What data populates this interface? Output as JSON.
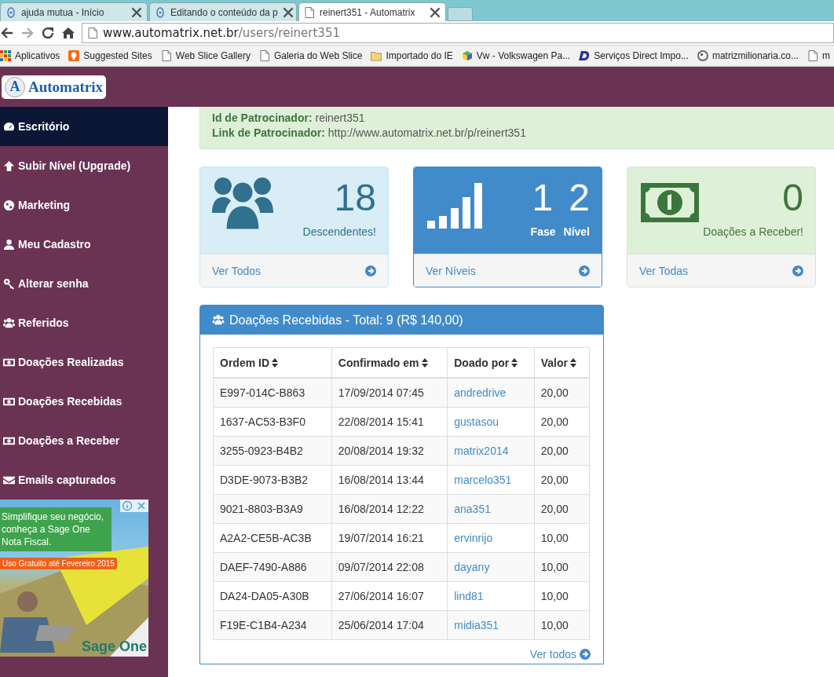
{
  "browser": {
    "tabs": [
      {
        "title": "ajuda mutua - Início",
        "kind": "site",
        "selected": false
      },
      {
        "title": "Editando o conteúdo da p",
        "kind": "site",
        "selected": false
      },
      {
        "title": "reinert351 - Automatrix",
        "kind": "page",
        "selected": true
      }
    ],
    "address": {
      "host": "www.automatrix.net.br",
      "path": "/users/reinert351"
    },
    "bookmarks": [
      {
        "label": "Aplicativos",
        "kind": "apps"
      },
      {
        "label": "Suggested Sites",
        "kind": "suggest"
      },
      {
        "label": "Web Slice Gallery",
        "kind": "page"
      },
      {
        "label": "Galeria do Web Slice",
        "kind": "page"
      },
      {
        "label": "Importado do IE",
        "kind": "folder"
      },
      {
        "label": "Vw - Volkswagen Pa...",
        "kind": "cube"
      },
      {
        "label": "Serviços Direct Impo...",
        "kind": "d"
      },
      {
        "label": "matrizmilionaria.co...",
        "kind": "globe"
      },
      {
        "label": "m",
        "kind": "page"
      }
    ]
  },
  "header": {
    "logo_letter": "A",
    "logo_text": "Automatrix"
  },
  "sidebar": {
    "items": [
      {
        "label": "Escritório",
        "kind": "dashboard",
        "selected": true
      },
      {
        "label": "Subir Nível (Upgrade)",
        "kind": "upgrade",
        "selected": false
      },
      {
        "label": "Marketing",
        "kind": "globe",
        "selected": false
      },
      {
        "label": "Meu Cadastro",
        "kind": "user",
        "selected": false
      },
      {
        "label": "Alterar senha",
        "kind": "key",
        "selected": false
      },
      {
        "label": "Referidos",
        "kind": "users",
        "selected": false
      },
      {
        "label": "Doações Realizadas",
        "kind": "money",
        "selected": false
      },
      {
        "label": "Doações Recebidas",
        "kind": "money",
        "selected": false
      },
      {
        "label": "Doações a Receber",
        "kind": "money",
        "selected": false
      },
      {
        "label": "Emails capturados",
        "kind": "envelope",
        "selected": false
      }
    ]
  },
  "ad": {
    "headline": "Simplifique seu negócio, conheça a Sage One Nota Fiscal.",
    "promo": "Uso Gratuito até Fevereiro 2015",
    "brand": "Sage One"
  },
  "alert": {
    "lines": [
      {
        "label": "Id de Patrocinador:",
        "value": "reinert351"
      },
      {
        "label": "Link de Patrocinador:",
        "value": "http://www.automatrix.net.br/p/reinert351"
      }
    ]
  },
  "stats": [
    {
      "kind": "info",
      "values": [
        "18"
      ],
      "labels": [
        "Descendentes!"
      ],
      "link": "Ver Todos"
    },
    {
      "kind": "primary",
      "values": [
        "1",
        "2"
      ],
      "labels": [
        "Fase",
        "Nível"
      ],
      "link": "Ver Níveis"
    },
    {
      "kind": "success",
      "values": [
        "0"
      ],
      "labels": [
        "Doações a Receber!"
      ],
      "link": "Ver Todas"
    }
  ],
  "donations": {
    "title": "Doações Recebidas - Total: 9 (R$ 140,00)",
    "columns": [
      "Ordem ID",
      "Confirmado em",
      "Doado por",
      "Valor"
    ],
    "rows": [
      [
        "E997-014C-B863",
        "17/09/2014 07:45",
        "andredrive",
        "20,00"
      ],
      [
        "1637-AC53-B3F0",
        "22/08/2014 15:41",
        "gustasou",
        "20,00"
      ],
      [
        "3255-0923-B4B2",
        "20/08/2014 19:32",
        "matrix2014",
        "20,00"
      ],
      [
        "D3DE-9073-B3B2",
        "16/08/2014 13:44",
        "marcelo351",
        "20,00"
      ],
      [
        "9021-8803-B3A9",
        "16/08/2014 12:22",
        "ana351",
        "20,00"
      ],
      [
        "A2A2-CE5B-AC3B",
        "19/07/2014 16:21",
        "ervinrijo",
        "10,00"
      ],
      [
        "DAEF-7490-A886",
        "09/07/2014 22:08",
        "dayany",
        "10,00"
      ],
      [
        "DA24-DA05-A30B",
        "27/06/2014 16:07",
        "lind81",
        "10,00"
      ],
      [
        "F19E-C1B4-A234",
        "25/06/2014 17:04",
        "midia351",
        "10,00"
      ]
    ],
    "footer_link": "Ver todos"
  }
}
